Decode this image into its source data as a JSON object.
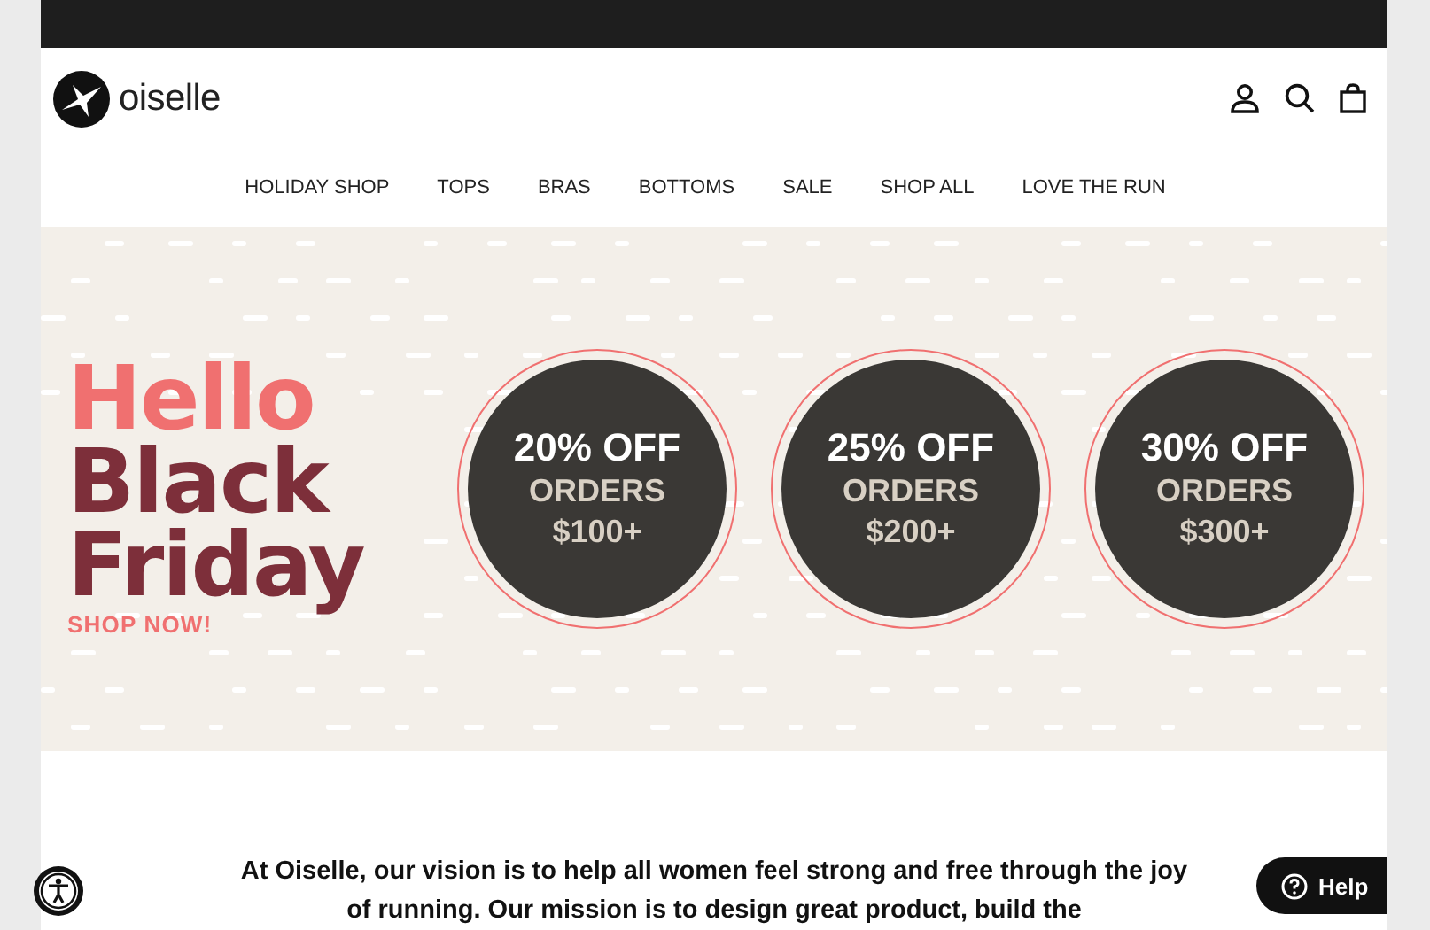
{
  "header": {
    "logo_text": "oiselle"
  },
  "nav": [
    {
      "label": "HOLIDAY SHOP"
    },
    {
      "label": "TOPS"
    },
    {
      "label": "BRAS"
    },
    {
      "label": "BOTTOMS"
    },
    {
      "label": "SALE"
    },
    {
      "label": "SHOP ALL"
    },
    {
      "label": "LOVE THE RUN"
    }
  ],
  "banner": {
    "headline": [
      "Hello",
      "Black",
      "Friday"
    ],
    "cta": "SHOP NOW!",
    "offers": [
      {
        "discount": "20% OFF",
        "line_1": "ORDERS",
        "line_2": "$100+"
      },
      {
        "discount": "25% OFF",
        "line_1": "ORDERS",
        "line_2": "$200+"
      },
      {
        "discount": "30% OFF",
        "line_1": "ORDERS",
        "line_2": "$300+"
      }
    ]
  },
  "mission": "At Oiselle, our vision is to help all women feel strong and free through the joy of running. Our mission is to design great product, build the",
  "help_button": "Help"
}
